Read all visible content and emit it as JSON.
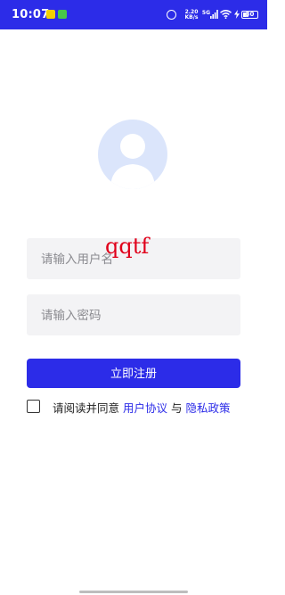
{
  "status_bar": {
    "time": "10:07",
    "net_speed_value": "2.20",
    "net_speed_unit": "KB/s",
    "net_type": "5G",
    "battery_level": "30",
    "colors": {
      "background": "#2c2ce8",
      "foreground": "#ffffff"
    }
  },
  "overlay_text": "qqtf",
  "form": {
    "username_placeholder": "请输入用户名",
    "password_placeholder": "请输入密码",
    "register_label": "立即注册",
    "agreement_prefix": "请阅读并同意 ",
    "user_agreement_link": "用户协议",
    "agreement_join": " 与 ",
    "privacy_policy_link": "隐私政策",
    "agreement_checked": false
  },
  "colors": {
    "accent": "#2c2ce8",
    "field_background": "#f3f3f5",
    "avatar_background": "#dbe5fb",
    "avatar_silhouette": "#9ebcf5",
    "overlay_text": "#e0001a"
  },
  "icons": [
    "alarm-icon",
    "signal-icon",
    "wifi-icon",
    "charging-icon",
    "battery-icon",
    "avatar-icon",
    "checkbox-icon"
  ]
}
